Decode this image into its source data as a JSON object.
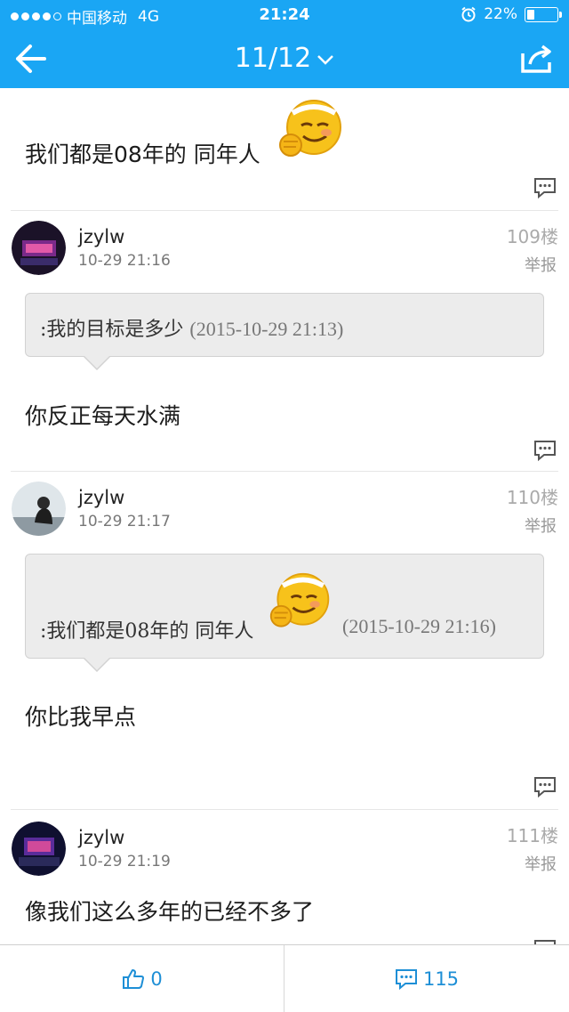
{
  "status": {
    "carrier": "中国移动",
    "network": "4G",
    "time": "21:24",
    "battery": "22%",
    "battery_level": 0.22
  },
  "nav": {
    "page_indicator": "11/12"
  },
  "posts": [
    {
      "id": "top",
      "text": "我们都是08年的 同年人"
    },
    {
      "id": "p109",
      "username": "jzylw",
      "time": "10-29 21:16",
      "floor": "109楼",
      "report": "举报",
      "quote_text": ":我的目标是多少",
      "quote_date": "(2015-10-29 21:13)",
      "text": "你反正每天水满"
    },
    {
      "id": "p110",
      "username": "jzylw",
      "time": "10-29 21:17",
      "floor": "110楼",
      "report": "举报",
      "quote_text": ":我们都是08年的 同年人",
      "quote_date": "(2015-10-29 21:16)",
      "text": "你比我早点"
    },
    {
      "id": "p111",
      "username": "jzylw",
      "time": "10-29 21:19",
      "floor": "111楼",
      "report": "举报",
      "text": "像我们这么多年的已经不多了"
    }
  ],
  "bottom": {
    "like_count": "0",
    "comment_count": "115"
  },
  "icons": {
    "back": "back-arrow-icon",
    "share": "share-icon",
    "reply": "comment-bubble-icon",
    "like": "thumbs-up-icon",
    "emoji": "grinning-emoji-icon"
  },
  "colors": {
    "topbar": "#1aa6f4",
    "accent": "#1e8fd6"
  }
}
